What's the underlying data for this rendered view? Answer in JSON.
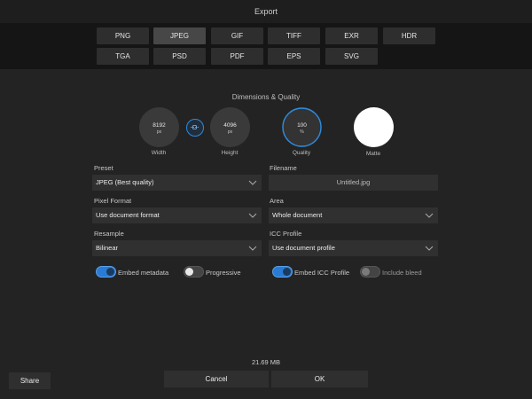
{
  "window": {
    "title": "Export"
  },
  "formats": [
    "PNG",
    "JPEG",
    "GIF",
    "TIFF",
    "EXR",
    "HDR",
    "TGA",
    "PSD",
    "PDF",
    "EPS",
    "SVG"
  ],
  "selected_format": "JPEG",
  "dimensions": {
    "section_title": "Dimensions & Quality",
    "width": {
      "value": "8192",
      "unit": "px",
      "label": "Width"
    },
    "height": {
      "value": "4096",
      "unit": "px",
      "label": "Height"
    },
    "quality": {
      "value": "100",
      "unit": "%",
      "label": "Quality",
      "level": 1.0
    },
    "matte": {
      "label": "Matte",
      "color": "#ffffff"
    },
    "link_icon": "chain-link-icon"
  },
  "left": {
    "preset": {
      "label": "Preset",
      "value": "JPEG (Best quality)"
    },
    "pixel_format": {
      "label": "Pixel Format",
      "value": "Use document format"
    },
    "resample": {
      "label": "Resample",
      "value": "Bilinear"
    }
  },
  "right": {
    "filename": {
      "label": "Filename",
      "placeholder": "Untitled.jpg"
    },
    "area": {
      "label": "Area",
      "value": "Whole document"
    },
    "icc_profile": {
      "label": "ICC Profile",
      "value": "Use document profile"
    }
  },
  "toggles": {
    "embed_metadata": {
      "label": "Embed metadata",
      "on": true
    },
    "progressive": {
      "label": "Progressive",
      "on": false
    },
    "embed_icc": {
      "label": "Embed ICC Profile",
      "on": true
    },
    "include_bleed": {
      "label": "Include bleed",
      "on": false
    }
  },
  "footer": {
    "file_size": "21.69 MB",
    "share_label": "Share",
    "cancel_label": "Cancel",
    "ok_label": "OK"
  },
  "colors": {
    "accent": "#2d8be0",
    "background": "#232323"
  }
}
